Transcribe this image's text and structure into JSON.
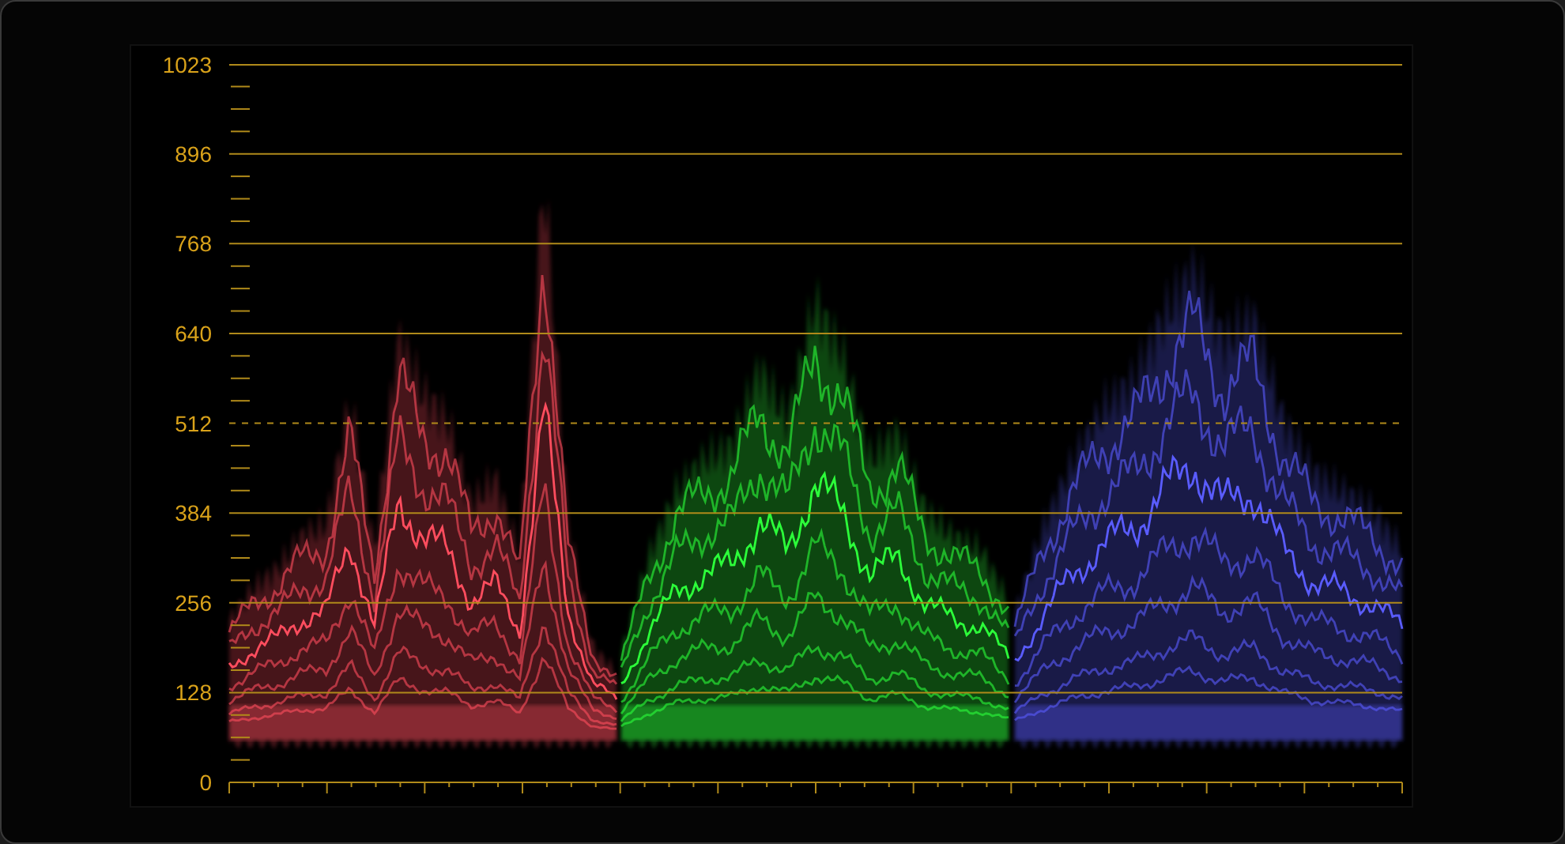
{
  "scope": {
    "y_labels": [
      "1023",
      "896",
      "768",
      "640",
      "512",
      "384",
      "256",
      "128",
      "0"
    ]
  },
  "channels": [
    {
      "color": "#ff4d5e"
    },
    {
      "color": "#2cff3a"
    },
    {
      "color": "#5a5cff"
    }
  ]
}
